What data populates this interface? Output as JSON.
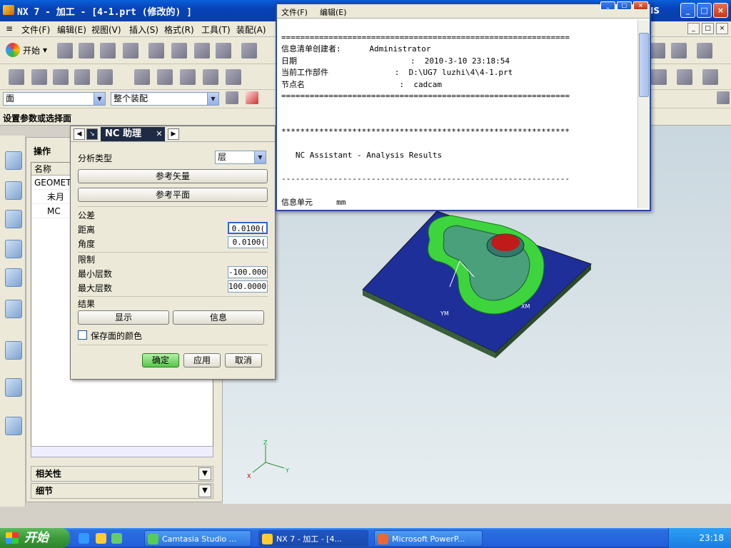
{
  "window": {
    "title": "NX 7 - 加工 - [4-1.prt  (修改的) ]",
    "brand": "NS"
  },
  "menu": [
    "文件(F)",
    "编辑(E)",
    "视图(V)",
    "插入(S)",
    "格式(R)",
    "工具(T)",
    "装配(A)"
  ],
  "toolbar": {
    "start_label": "开始",
    "filter_value": "面",
    "scope_value": "整个装配"
  },
  "cue_line": "设置参数或选择面",
  "navigator": {
    "header": "操作",
    "column": "名称",
    "rows": [
      "GEOMETI",
      "未月",
      "MC"
    ],
    "sections": [
      "相关性",
      "细节"
    ]
  },
  "nc_dialog": {
    "title": "NC 助理",
    "analysis_type_label": "分析类型",
    "analysis_type_value": "层",
    "ref_vector_btn": "参考矢量",
    "ref_plane_btn": "参考平面",
    "tolerance_label": "公差",
    "distance_label": "距离",
    "distance_value": "0.0100(",
    "angle_label": "角度",
    "angle_value": "0.0100(",
    "limits_label": "限制",
    "min_layer_label": "最小层数",
    "min_layer_value": "-100.0000",
    "max_layer_label": "最大层数",
    "max_layer_value": "100.0000(",
    "results_label": "结果",
    "display_btn": "显示",
    "info_btn": "信息",
    "save_color_label": "保存面的颜色",
    "ok_btn": "确定",
    "apply_btn": "应用",
    "cancel_btn": "取消"
  },
  "info_window": {
    "menu_file": "文件(F)",
    "menu_edit": "编辑(E)",
    "lines": [
      "=============================================================",
      "信息清单创建者:      Administrator",
      "日期                        :  2010-3-10 23:18:54",
      "当前工作部件              :  D:\\UG7 luzhi\\4\\4-1.prt",
      "节点名                    :  cadcam",
      "=============================================================",
      "",
      "",
      "*************************************************************",
      "",
      "   NC Assistant - Analysis Results",
      "",
      "-------------------------------------------------------------",
      "",
      "信息单元     mm"
    ]
  },
  "axes": {
    "x": "X",
    "y": "Y",
    "z": "Z"
  },
  "taskbar": {
    "start": "开始",
    "tasks": [
      "Camtasia Studio ...",
      "NX 7 - 加工 - [4...",
      "Microsoft PowerP..."
    ],
    "clock": "23:18"
  }
}
